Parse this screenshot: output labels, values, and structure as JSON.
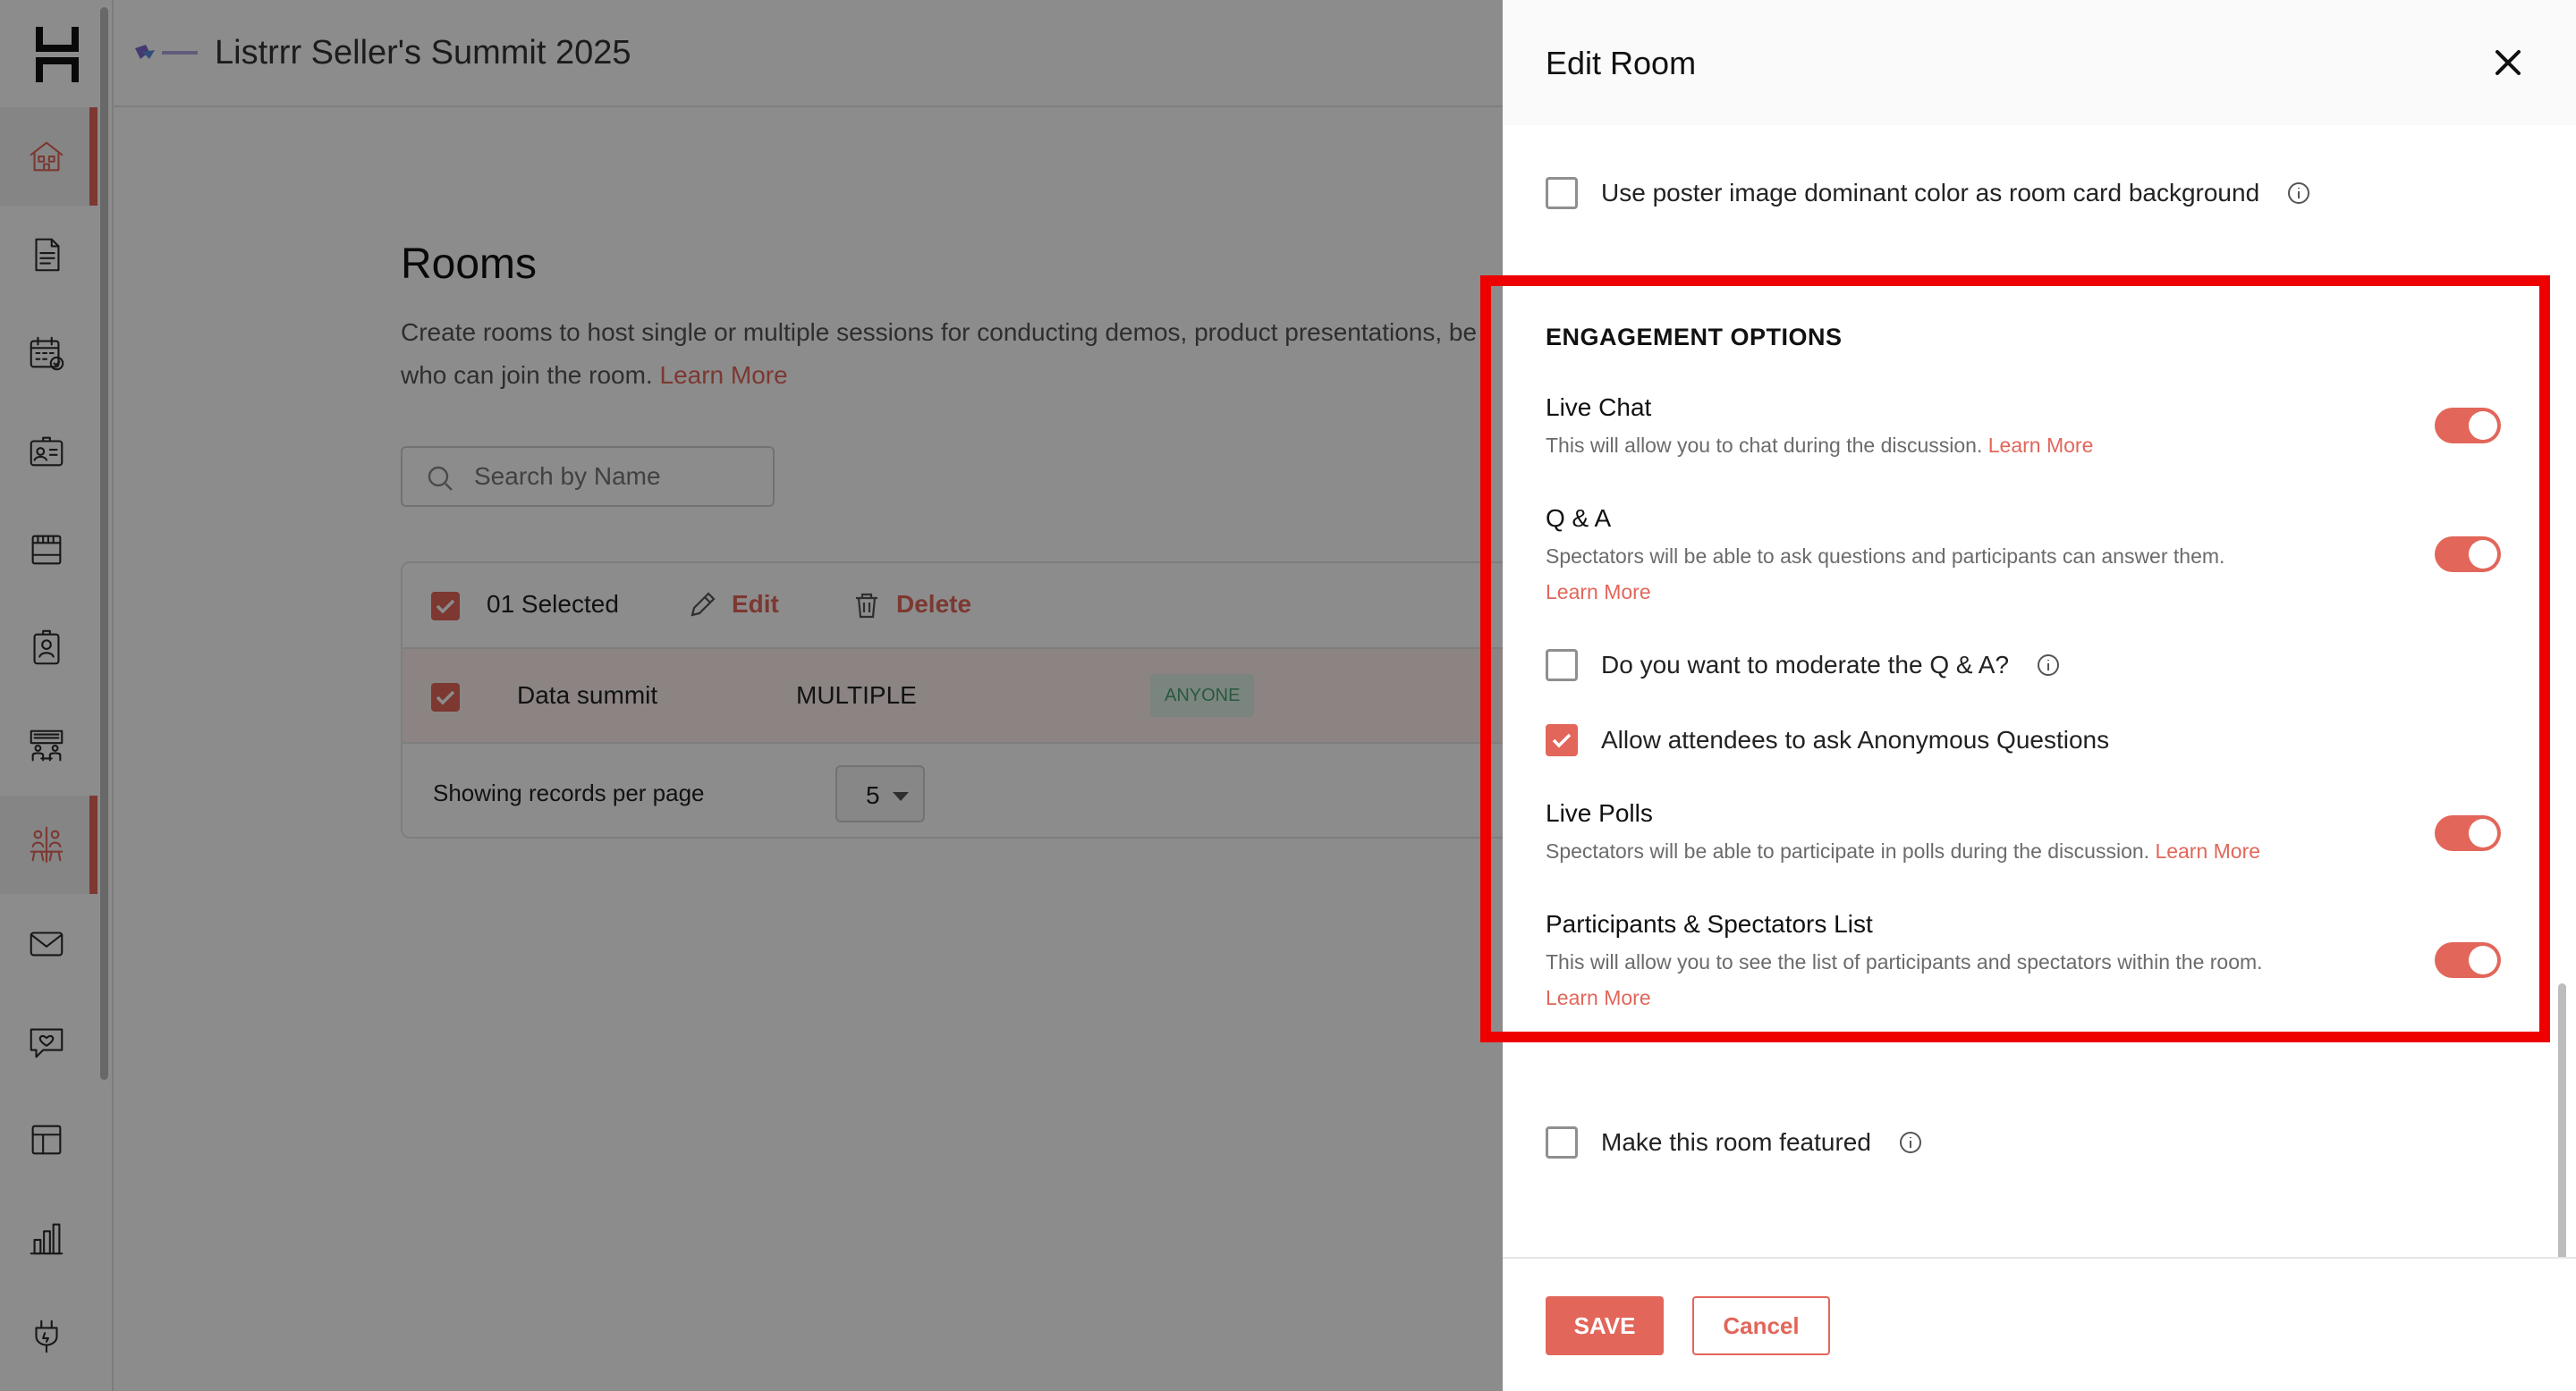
{
  "header": {
    "event_title": "Listrrr Seller's Summit 2025"
  },
  "sidebar": {
    "items": [
      {
        "name": "lobby",
        "icon": "building-icon",
        "active": true
      },
      {
        "name": "documents",
        "icon": "document-icon"
      },
      {
        "name": "agenda",
        "icon": "calendar-check-icon"
      },
      {
        "name": "registration",
        "icon": "id-card-icon"
      },
      {
        "name": "booths",
        "icon": "storefront-icon"
      },
      {
        "name": "speakers",
        "icon": "badge-icon"
      },
      {
        "name": "stage",
        "icon": "stage-icon"
      },
      {
        "name": "rooms",
        "icon": "rooms-icon",
        "active": true
      },
      {
        "name": "mail",
        "icon": "mail-icon"
      },
      {
        "name": "engagement",
        "icon": "chat-heart-icon"
      },
      {
        "name": "layout",
        "icon": "layout-icon"
      },
      {
        "name": "analytics",
        "icon": "bar-chart-icon"
      },
      {
        "name": "integrations",
        "icon": "plug-icon"
      }
    ]
  },
  "main": {
    "title": "Rooms",
    "description": "Create rooms to host single or multiple sessions for conducting demos, product presentations, be",
    "description_line2": "who can join the room.",
    "learn_more": "Learn More",
    "search": {
      "placeholder": "Search by Name",
      "value": ""
    },
    "table": {
      "selected_label": "01 Selected",
      "edit_label": "Edit",
      "delete_label": "Delete",
      "rows": [
        {
          "name": "Data summit",
          "type": "MULTIPLE",
          "access": "ANYONE",
          "selected": true
        }
      ],
      "records_per_page_label": "Showing records per page",
      "records_per_page_value": "5"
    }
  },
  "drawer": {
    "title": "Edit Room",
    "poster_color_option": {
      "label": "Use poster image dominant color as room card background",
      "checked": false
    },
    "engagement": {
      "section_title": "ENGAGEMENT OPTIONS",
      "live_chat": {
        "title": "Live Chat",
        "desc": "This will allow you to chat during the discussion.",
        "learn_more": "Learn More",
        "enabled": true
      },
      "qa": {
        "title": "Q & A",
        "desc": "Spectators will be able to ask questions and participants can answer them.",
        "learn_more": "Learn More",
        "enabled": true
      },
      "moderate_qa": {
        "label": "Do you want to moderate the Q & A?",
        "checked": false
      },
      "anonymous_questions": {
        "label": "Allow attendees to ask Anonymous Questions",
        "checked": true
      },
      "live_polls": {
        "title": "Live Polls",
        "desc": "Spectators will be able to participate in polls during the discussion.",
        "learn_more": "Learn More",
        "enabled": true
      },
      "participants_list": {
        "title": "Participants & Spectators List",
        "desc": "This will allow you to see the list of participants and spectators within the room.",
        "learn_more": "Learn More",
        "enabled": true
      }
    },
    "featured_option": {
      "label": "Make this room featured",
      "checked": false
    },
    "save_label": "SAVE",
    "cancel_label": "Cancel"
  },
  "colors": {
    "accent": "#e2665a",
    "highlight": "#ee0000",
    "badge_bg": "#dff3e8",
    "badge_text": "#4aa272"
  }
}
